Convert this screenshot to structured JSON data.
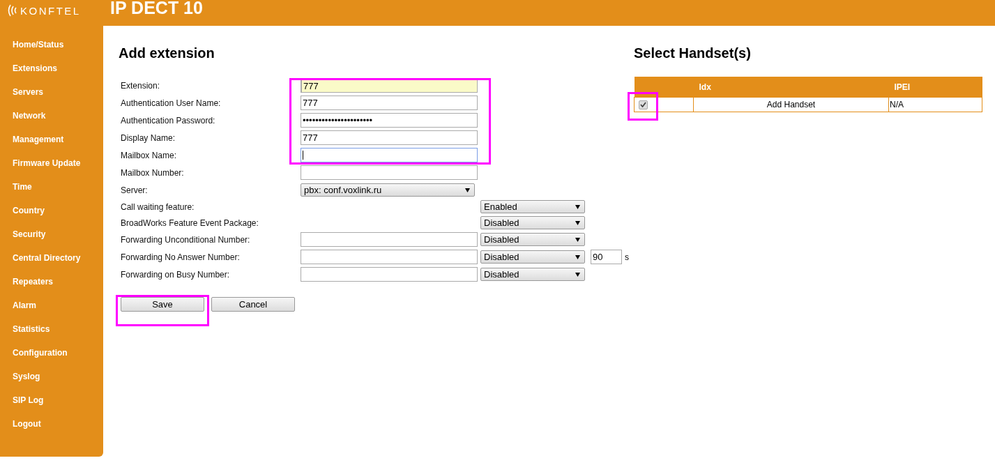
{
  "header": {
    "logo": "KONFTEL",
    "title": "IP DECT 10"
  },
  "sidebar": {
    "items": [
      {
        "label": "Home/Status"
      },
      {
        "label": "Extensions"
      },
      {
        "label": "Servers"
      },
      {
        "label": "Network"
      },
      {
        "label": "Management"
      },
      {
        "label": "Firmware Update"
      },
      {
        "label": "Time"
      },
      {
        "label": "Country"
      },
      {
        "label": "Security"
      },
      {
        "label": "Central Directory"
      },
      {
        "label": "Repeaters"
      },
      {
        "label": "Alarm"
      },
      {
        "label": "Statistics"
      },
      {
        "label": "Configuration"
      },
      {
        "label": "Syslog"
      },
      {
        "label": "SIP Log"
      },
      {
        "label": "Logout"
      }
    ]
  },
  "form": {
    "title": "Add extension",
    "rows": [
      {
        "label": "Extension:",
        "field": {
          "value": "777",
          "autofilled": true,
          "focused": false
        }
      },
      {
        "label": "Authentication User Name:",
        "field": {
          "value": "777",
          "autofilled": false,
          "focused": false
        }
      },
      {
        "label": "Authentication Password:",
        "field": {
          "value": "••••••••••••••••••••••",
          "autofilled": false,
          "focused": false
        }
      },
      {
        "label": "Display Name:",
        "field": {
          "value": "777",
          "autofilled": false,
          "focused": false
        }
      },
      {
        "label": "Mailbox Name:",
        "field": {
          "autofilled": false,
          "focused": true
        }
      },
      {
        "label": "Mailbox Number:",
        "field": {
          "autofilled": false,
          "focused": false
        }
      },
      {
        "label": "Server:",
        "wide_select": "pbx: conf.voxlink.ru"
      },
      {
        "label": "Call waiting feature:",
        "select": "Enabled"
      },
      {
        "label": "BroadWorks Feature Event Package:",
        "select": "Disabled"
      },
      {
        "label": "Forwarding Unconditional Number:",
        "field": {
          "autofilled": false,
          "focused": false
        },
        "select": "Disabled"
      },
      {
        "label": "Forwarding No Answer Number:",
        "field": {
          "autofilled": false,
          "focused": false
        },
        "select": "Disabled",
        "timeout": "90",
        "unit": "s"
      },
      {
        "label": "Forwarding on Busy Number:",
        "field": {
          "autofilled": false,
          "focused": false
        },
        "select": "Disabled"
      }
    ],
    "buttons": [
      "Save",
      "Cancel"
    ]
  },
  "handsets": {
    "title": "Select Handset(s)",
    "columns": [
      "Idx",
      "IPEI"
    ],
    "rows": [
      {
        "checked": true,
        "idx": "Add Handset",
        "ipei": "N/A"
      }
    ]
  }
}
